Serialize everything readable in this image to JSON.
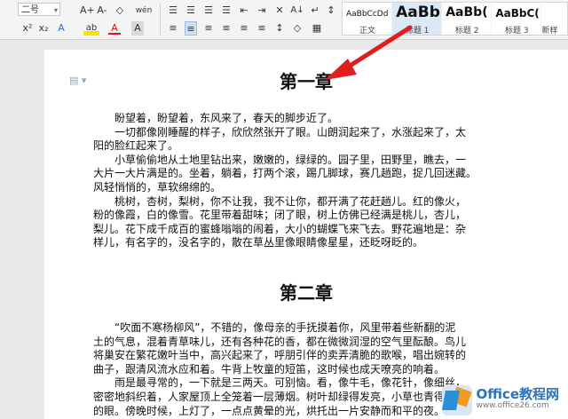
{
  "toolbar": {
    "font_size": "二号",
    "row1_icons": [
      "A+",
      "A-",
      "◇",
      "wén"
    ],
    "row2_icons": [
      "x²",
      "x₂",
      "A",
      "ab",
      "A",
      "A"
    ],
    "para_row1": [
      "☰",
      "☰",
      "☰",
      "☰",
      "⇤",
      "⇥",
      "✕",
      "A↓",
      "↵",
      "↕"
    ],
    "para_row2": [
      "≡",
      "≡",
      "≡",
      "≡",
      "≡",
      "≡",
      "↕",
      "◇",
      "▦"
    ]
  },
  "styles": {
    "items": [
      {
        "preview": "AaBbCcDd",
        "name": "正文"
      },
      {
        "preview": "AaBb",
        "name": "标题 1"
      },
      {
        "preview": "AaBb(",
        "name": "标题 2"
      },
      {
        "preview": "AaBbC(",
        "name": "标题 3"
      },
      {
        "preview": "",
        "name": "新样"
      }
    ]
  },
  "document": {
    "chapter1": {
      "title": "第一章",
      "paragraphs": [
        [
          "盼望着，盼望着，东风来了，春天的脚步近了。"
        ],
        [
          "一切都像刚睡醒的样子，欣欣然张开了眼。山朗润起来了，水涨起来了，太",
          "阳的脸红起来了。"
        ],
        [
          "小草偷偷地从土地里钻出来，嫩嫩的，绿绿的。园子里，田野里，瞧去，一",
          "大片一大片满是的。坐着，躺着，打两个滚，踢几脚球，赛几趟跑，捉几回迷藏。",
          "风轻悄悄的，草软绵绵的。"
        ],
        [
          "桃树，杏树，梨树，你不让我，我不让你，都开满了花赶趟儿。红的像火，",
          "粉的像霞，白的像雪。花里带着甜味；闭了眼，树上仿佛已经满是桃儿，杏儿，",
          "梨儿。花下成千成百的蜜蜂嗡嗡的闹着，大小的蝴蝶飞来飞去。野花遍地是：杂",
          "样儿，有名字的，没名字的，散在草丛里像眼睛像星星，还眨呀眨的。"
        ]
      ]
    },
    "chapter2": {
      "title": "第二章",
      "paragraphs": [
        [
          "“吹面不寒杨柳风”，不错的，像母亲的手抚摸着你，风里带着些新翻的泥",
          "土的气息，混着青草味儿，还有各种花的香，都在微微润湿的空气里酝酿。鸟儿",
          "将巢安在繁花嫩叶当中，高兴起来了，呼朋引伴的卖弄清脆的歌喉，唱出婉转的",
          "曲子，跟清风流水应和着。牛背上牧童的短笛，这时候也成天嘹亮的响着。"
        ],
        [
          "雨是最寻常的，一下就是三两天。可别恼。看，像牛毛，像花针，像细丝，",
          "密密地斜织着，人家屋顶上全笼着一层薄烟。树叶却绿得发亮，小草也青得逼你",
          "的眼。傍晚时候，上灯了，一点点黄晕的光，烘托出一片安静而和平的夜。在乡"
        ]
      ]
    }
  },
  "watermark": {
    "name": "Office教程网",
    "url": "www.office26.com"
  }
}
